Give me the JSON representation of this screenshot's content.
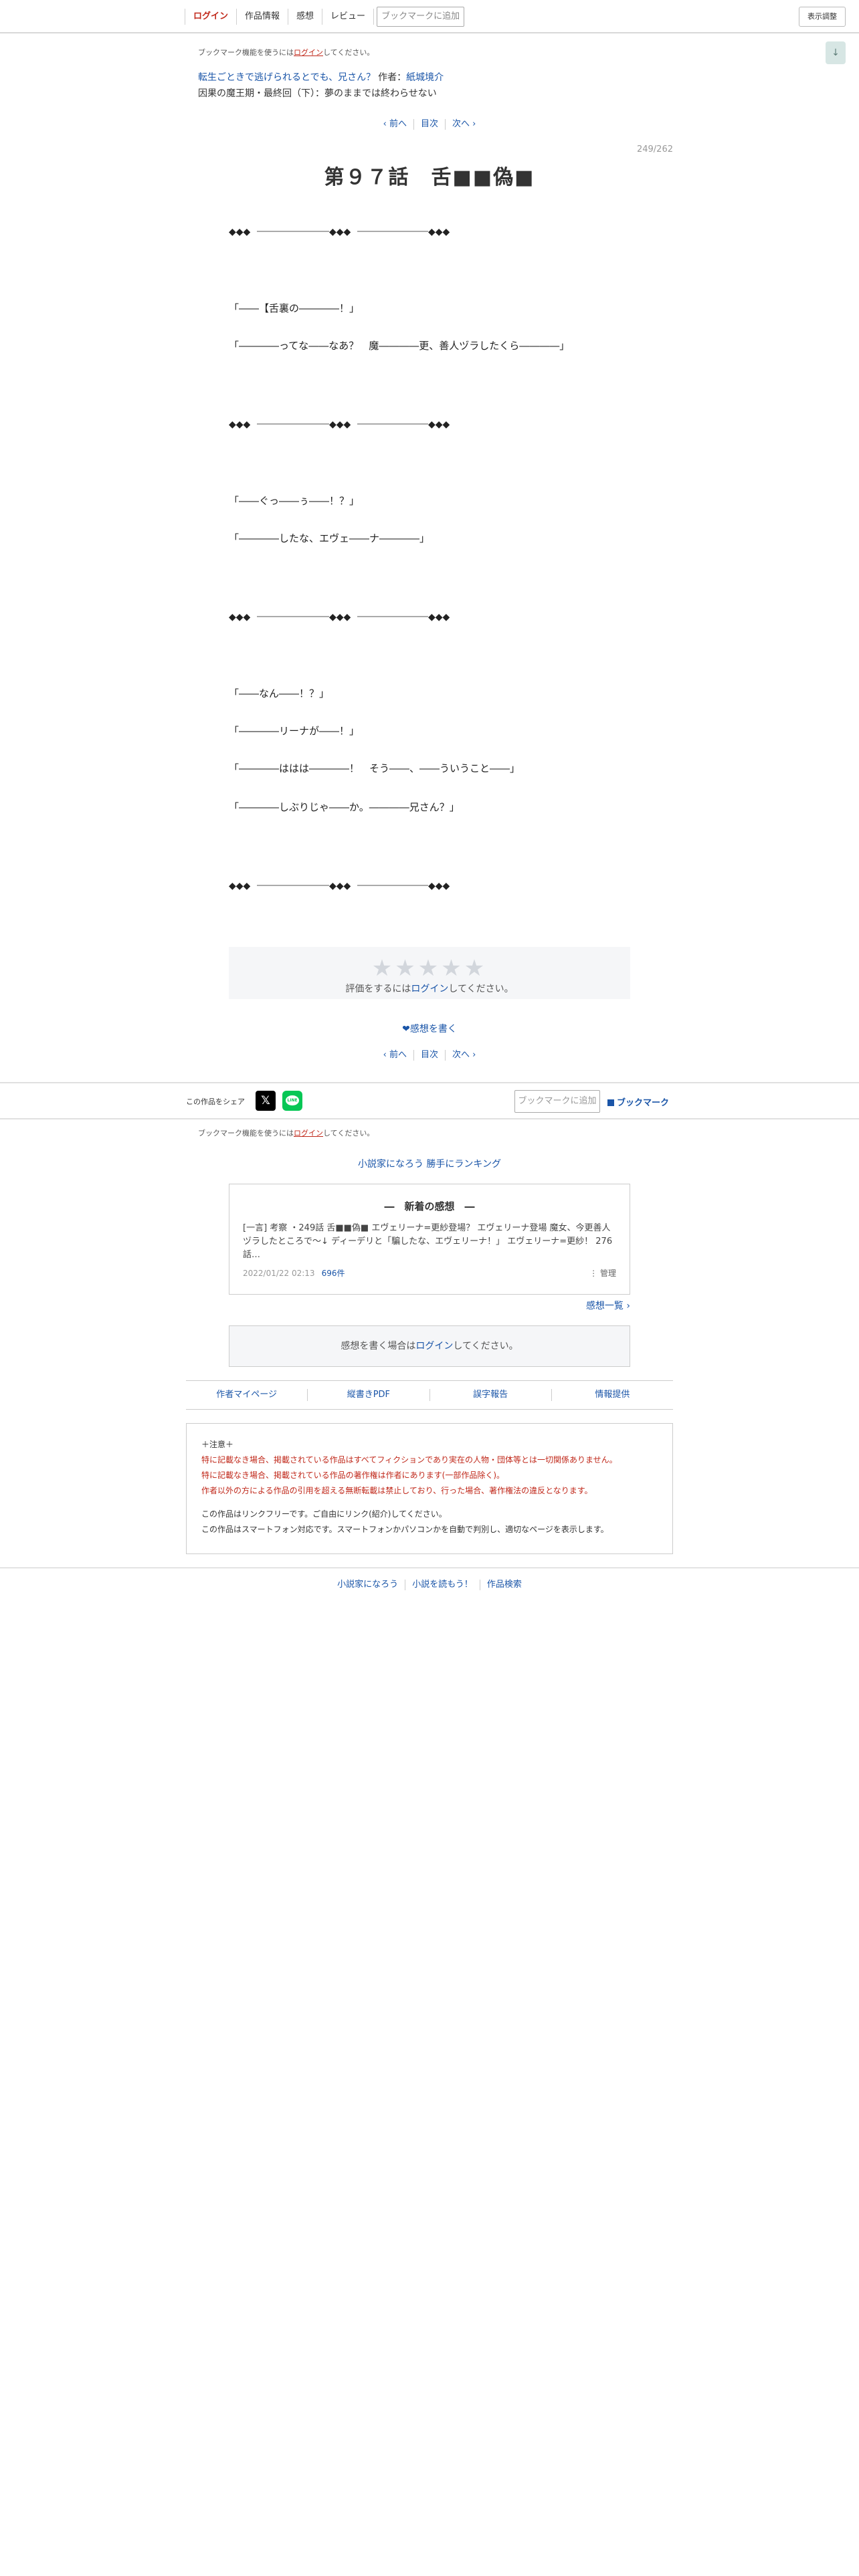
{
  "header": {
    "login": "ログイン",
    "nav": [
      "作品情報",
      "感想",
      "レビュー"
    ],
    "bookmark_add": "ブックマークに追加",
    "display_settings": "表示調整",
    "scroll_down": "↓"
  },
  "top": {
    "bookmark_notice_pre": "ブックマーク機能を使うには",
    "bookmark_notice_link": "ログイン",
    "bookmark_notice_post": "してください。",
    "work_title": "転生ごときで逃げられるとでも、兄さん？",
    "author_label": "作者：",
    "author": "紙城境介",
    "chapter": "因果の魔王期・最終回（下）：夢のままでは終わらせない",
    "page_count": "249/262"
  },
  "pager": [
    "‹ 前へ",
    "目次",
    "次へ ›"
  ],
  "episode": {
    "title": "第９７話　舌■■偽■",
    "dividers": [
      "◆◆◆",
      "◆◆◆",
      "◆◆◆"
    ],
    "lines": [
      "「――【舌裏の――――！」",
      "「――――ってな――なあ？　魔――――更、善人ヅラしたくら――――」",
      "「――ぐっ――ぅ――！？」",
      "「――――したな、エヴェ――ナ――――」",
      "「――なん――！？」",
      "「――――リーナが――！」",
      "「――――ははは――――！　そう――、――ういうこと――」",
      "「――――しぶりじゃ――か。――――兄さん？」"
    ]
  },
  "rating": {
    "stars": "★★★★★",
    "msg_pre": "評価をするには",
    "msg_link": "ログイン",
    "msg_post": "してください。"
  },
  "write_review": "❤感想を書く",
  "share": {
    "label": "この作品をシェア",
    "x_icon": "𝕏",
    "line_icon": "LINE",
    "bookmark_add": "ブックマークに追加",
    "bookmark": "ブックマーク"
  },
  "bottom_bookmark_notice": {
    "pre": "ブックマーク機能を使うには",
    "link": "ログイン",
    "post": "してください。"
  },
  "ranking_link": "小説家になろう 勝手にランキング",
  "recent_review": {
    "heading": "―　新着の感想　―",
    "body": "[一言] 考察 ・249話 舌■■偽■ エヴェリーナ=更紗登場？ エヴェリーナ登場 魔女、今更善人ヅラしたところで〜↓ ディーデリと「騙したな、エヴェリーナ！」 エヴェリーナ=更紗！ 276話…",
    "date": "2022/01/22 02:13",
    "count": "696件",
    "admin": "⋮ 管理",
    "all_link": "感想一覧 ›"
  },
  "login_box": {
    "pre": "感想を書く場合は",
    "link": "ログイン",
    "post": "してください。"
  },
  "tools": [
    "作者マイページ",
    "縦書きPDF",
    "誤字報告",
    "情報提供"
  ],
  "notice": {
    "head": "＋注意＋",
    "red_lines": [
      "特に記載なき場合、掲載されている作品はすべてフィクションであり実在の人物・団体等とは一切関係ありません。",
      "特に記載なき場合、掲載されている作品の著作権は作者にあります(一部作品除く)。",
      "作者以外の方による作品の引用を超える無断転載は禁止しており、行った場合、著作権法の違反となります。"
    ],
    "plain_lines": [
      "この作品はリンクフリーです。ご自由にリンク(紹介)してください。",
      "この作品はスマートフォン対応です。スマートフォンかパソコンかを自動で判別し、適切なページを表示します。"
    ]
  },
  "footer": [
    "小説家になろう",
    "小説を読もう！",
    "作品検索"
  ]
}
